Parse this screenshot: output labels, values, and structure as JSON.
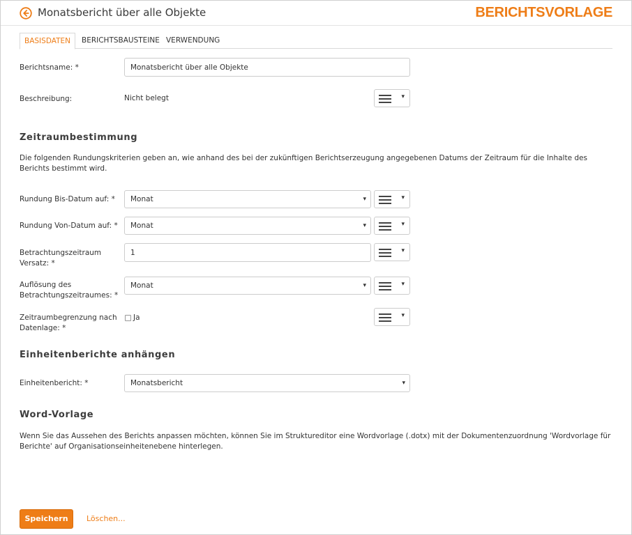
{
  "header": {
    "title": "Monatsbericht über alle Objekte",
    "brand": "BERICHTSVORLAGE",
    "back_icon": "arrow-left-circle-icon",
    "accent_color": "#ee7d17"
  },
  "tabs": [
    {
      "label": "BASISDATEN",
      "active": true
    },
    {
      "label": "BERICHTSBAUSTEINE",
      "active": false
    },
    {
      "label": "VERWENDUNG",
      "active": false
    }
  ],
  "form": {
    "berichtsname": {
      "label": "Berichtsname: *",
      "value": "Monatsbericht über alle Objekte"
    },
    "beschreibung": {
      "label": "Beschreibung:",
      "value": "Nicht belegt"
    }
  },
  "zeitraum": {
    "title": "Zeitraumbestimmung",
    "description": "Die folgenden Rundungskriterien geben an, wie anhand des bei der zukünftigen Berichtserzeugung angegebenen Datums der Zeitraum für die Inhalte des Berichts bestimmt wird.",
    "bis_datum": {
      "label": "Rundung Bis-Datum auf: *",
      "value": "Monat"
    },
    "von_datum": {
      "label": "Rundung Von-Datum auf: *",
      "value": "Monat"
    },
    "versatz": {
      "label_line1": "Betrachtungszeitraum",
      "label_line2": "Versatz: *",
      "value": "1"
    },
    "aufloesung": {
      "label_line1": "Auflösung des",
      "label_line2": "Betrachtungszeitraumes: *",
      "value": "Monat"
    },
    "begrenzung": {
      "label_line1": "Zeitraumbegrenzung nach",
      "label_line2": "Datenlage: *",
      "checkbox_label": "Ja",
      "checked": false
    }
  },
  "einheiten": {
    "title": "Einheitenberichte anhängen",
    "label": "Einheitenbericht: *",
    "value": "Monatsbericht"
  },
  "word": {
    "title": "Word-Vorlage",
    "description": "Wenn Sie das Aussehen des Berichts anpassen möchten, können Sie im Strukturedit­or eine Wordvorlage (.dotx) mit der Dokumentenzuordnung 'Wordvorlage für Berichte' auf Organisationseinheitenebene hinterlegen."
  },
  "actions": {
    "save": "Speichern",
    "delete": "Löschen..."
  },
  "icons": {
    "menu": "hamburger-menu-icon",
    "caret": "▾"
  }
}
